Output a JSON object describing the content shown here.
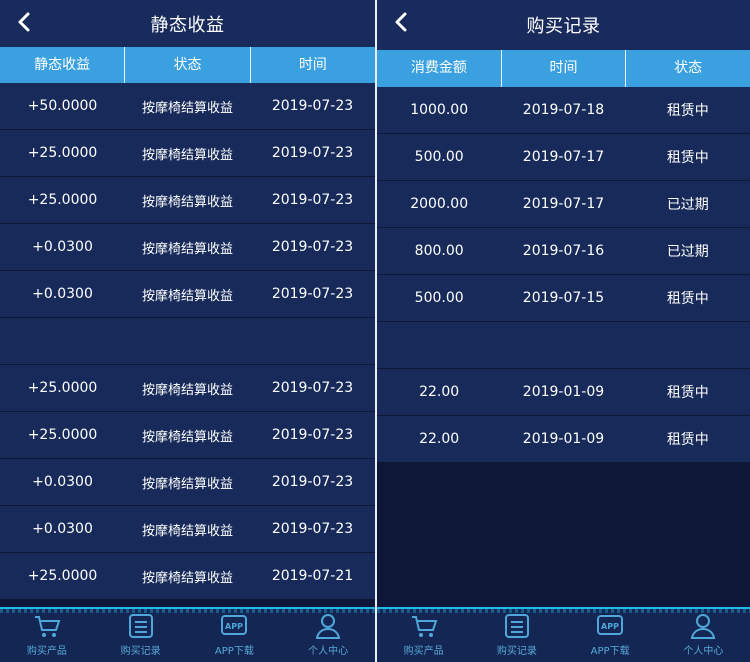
{
  "left": {
    "title": "静态收益",
    "columns": [
      "静态收益",
      "状态",
      "时间"
    ],
    "rows": [
      [
        "+50.0000",
        "按摩椅结算收益",
        "2019-07-23"
      ],
      [
        "+25.0000",
        "按摩椅结算收益",
        "2019-07-23"
      ],
      [
        "+25.0000",
        "按摩椅结算收益",
        "2019-07-23"
      ],
      [
        "+0.0300",
        "按摩椅结算收益",
        "2019-07-23"
      ],
      [
        "+0.0300",
        "按摩椅结算收益",
        "2019-07-23"
      ],
      [
        "",
        "",
        ""
      ],
      [
        "+25.0000",
        "按摩椅结算收益",
        "2019-07-23"
      ],
      [
        "+25.0000",
        "按摩椅结算收益",
        "2019-07-23"
      ],
      [
        "+0.0300",
        "按摩椅结算收益",
        "2019-07-23"
      ],
      [
        "+0.0300",
        "按摩椅结算收益",
        "2019-07-23"
      ],
      [
        "+25.0000",
        "按摩椅结算收益",
        "2019-07-21"
      ]
    ]
  },
  "right": {
    "title": "购买记录",
    "columns": [
      "消费金额",
      "时间",
      "状态"
    ],
    "rows": [
      [
        "1000.00",
        "2019-07-18",
        "租赁中"
      ],
      [
        "500.00",
        "2019-07-17",
        "租赁中"
      ],
      [
        "2000.00",
        "2019-07-17",
        "已过期"
      ],
      [
        "800.00",
        "2019-07-16",
        "已过期"
      ],
      [
        "500.00",
        "2019-07-15",
        "租赁中"
      ],
      [
        "",
        "",
        ""
      ],
      [
        "22.00",
        "2019-01-09",
        "租赁中"
      ],
      [
        "22.00",
        "2019-01-09",
        "租赁中"
      ]
    ]
  },
  "tabbar": {
    "items": [
      {
        "label": "购买产品",
        "icon": "cart-icon"
      },
      {
        "label": "购买记录",
        "icon": "list-icon"
      },
      {
        "label": "APP下载",
        "icon": "app-icon"
      },
      {
        "label": "个人中心",
        "icon": "user-icon"
      }
    ]
  },
  "colors": {
    "header_bg": "#182b5c",
    "table_head_bg": "#3aa0e0",
    "row_bg": "#172a59",
    "page_bg": "#0e1738",
    "tab_accent": "#23b7e6"
  }
}
